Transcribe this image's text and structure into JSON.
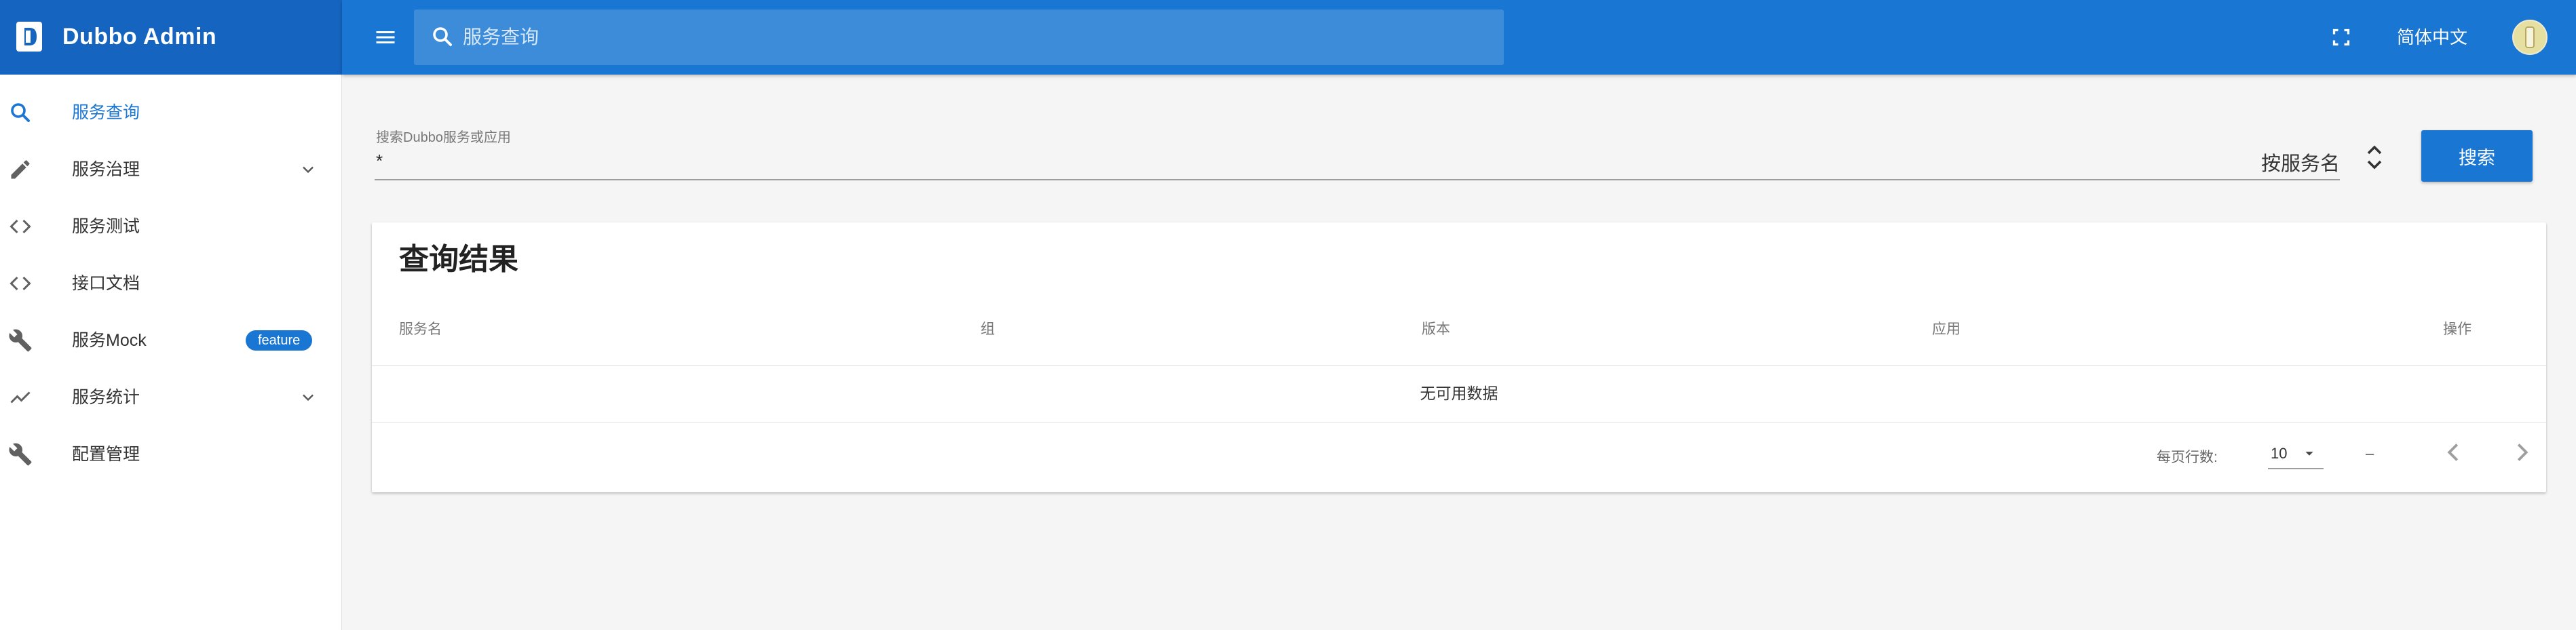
{
  "brand": {
    "title": "Dubbo Admin"
  },
  "nav": [
    {
      "label": "服务查询",
      "icon": "search-icon",
      "active": true
    },
    {
      "label": "服务治理",
      "icon": "pencil-icon",
      "expandable": true
    },
    {
      "label": "服务测试",
      "icon": "code-icon"
    },
    {
      "label": "接口文档",
      "icon": "code-icon"
    },
    {
      "label": "服务Mock",
      "icon": "wrench-icon",
      "badge": "feature"
    },
    {
      "label": "服务统计",
      "icon": "trend-icon",
      "expandable": true
    },
    {
      "label": "配置管理",
      "icon": "wrench-icon"
    }
  ],
  "topbar": {
    "search_placeholder": "服务查询",
    "language": "简体中文"
  },
  "search_form": {
    "label": "搜索Dubbo服务或应用",
    "value": "*",
    "search_by": "按服务名",
    "search_button": "搜索"
  },
  "results": {
    "title": "查询结果",
    "columns": [
      "服务名",
      "组",
      "版本",
      "应用",
      "操作"
    ],
    "empty_text": "无可用数据",
    "pagination": {
      "rows_per_page_label": "每页行数:",
      "rows_per_page": "10",
      "range": "–"
    }
  },
  "colors": {
    "primary": "#1976d2",
    "primary_dark": "#1565c0"
  }
}
